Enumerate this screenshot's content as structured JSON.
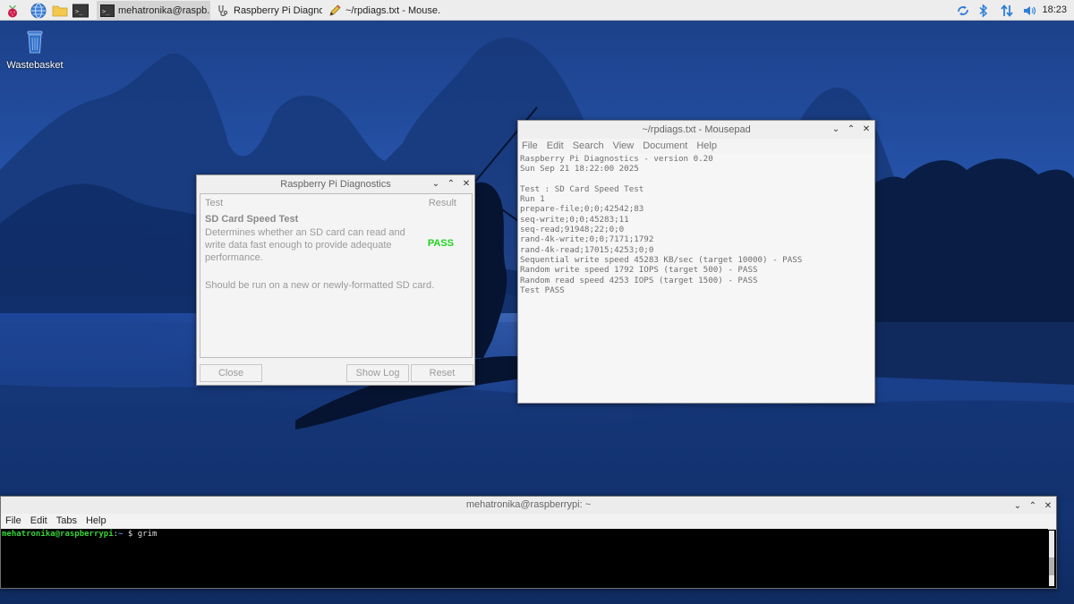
{
  "taskbar": {
    "windows": [
      {
        "label": "mehatronika@raspb..."
      },
      {
        "label": "Raspberry Pi Diagno..."
      },
      {
        "label": "~/rpdiags.txt - Mouse..."
      }
    ],
    "clock": "18:23"
  },
  "desktop": {
    "trash_label": "Wastebasket"
  },
  "diagnostics": {
    "title": "Raspberry Pi Diagnostics",
    "col_test": "Test",
    "col_result": "Result",
    "test_name": "SD Card Speed Test",
    "test_desc": "Determines whether an SD card can read and write data fast enough to provide adequate performance.",
    "test_note": "Should be run on a new or newly-formatted SD card.",
    "result": "PASS",
    "buttons": {
      "close": "Close",
      "show_log": "Show Log",
      "reset": "Reset"
    },
    "result_color": "#1ed31e"
  },
  "mousepad": {
    "title": "~/rpdiags.txt - Mousepad",
    "menu": [
      "File",
      "Edit",
      "Search",
      "View",
      "Document",
      "Help"
    ],
    "lines": [
      "Raspberry Pi Diagnostics - version 0.20",
      "Sun Sep 21 18:22:00 2025",
      "",
      "Test : SD Card Speed Test",
      "Run 1",
      "prepare-file;0;0;42542;83",
      "seq-write;0;0;45283;11",
      "seq-read;91948;22;0;0",
      "rand-4k-write;0;0;7171;1792",
      "rand-4k-read;17015;4253;0;0",
      "Sequential write speed 45283 KB/sec (target 10000) - PASS",
      "Random write speed 1792 IOPS (target 500) - PASS",
      "Random read speed 4253 IOPS (target 1500) - PASS",
      "Test PASS"
    ]
  },
  "terminal": {
    "title": "mehatronika@raspberrypi: ~",
    "menu": [
      "File",
      "Edit",
      "Tabs",
      "Help"
    ],
    "prompt_user": "mehatronika@raspberrypi",
    "prompt_path": "~",
    "command": "grim"
  }
}
